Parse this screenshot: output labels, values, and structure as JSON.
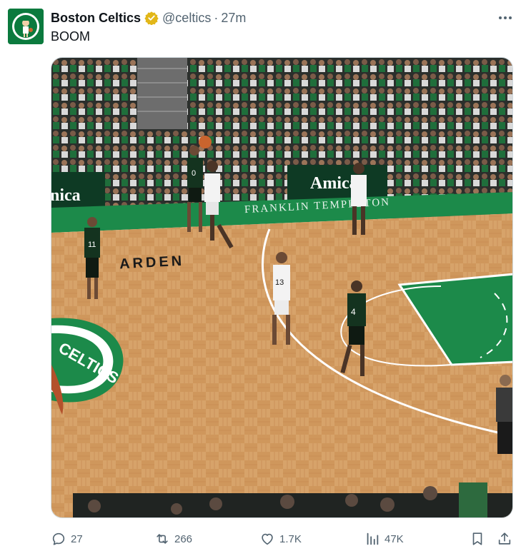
{
  "tweet": {
    "display_name": "Boston Celtics",
    "handle": "@celtics",
    "separator": "·",
    "time": "27m",
    "text": "BOOM",
    "verified_color": "#e2b719",
    "avatar_bg": "#0b7a3e"
  },
  "media": {
    "type": "video",
    "signage_left": "nica",
    "signage_mid": "Amica",
    "signage_courtside": "FRANKLIN TEMPLETON",
    "floor_text": "ARDEN",
    "logo_text": "CELTICS",
    "jerseys": {
      "shooter": "0",
      "defender": "11",
      "opponent_a": "13",
      "opponent_b": "4"
    }
  },
  "actions": {
    "reply": {
      "icon": "reply-icon",
      "count": "27"
    },
    "repost": {
      "icon": "repost-icon",
      "count": "266"
    },
    "like": {
      "icon": "heart-icon",
      "count": "1.7K"
    },
    "views": {
      "icon": "views-icon",
      "count": "47K"
    },
    "bookmark": {
      "icon": "bookmark-icon"
    },
    "share": {
      "icon": "share-icon"
    }
  }
}
